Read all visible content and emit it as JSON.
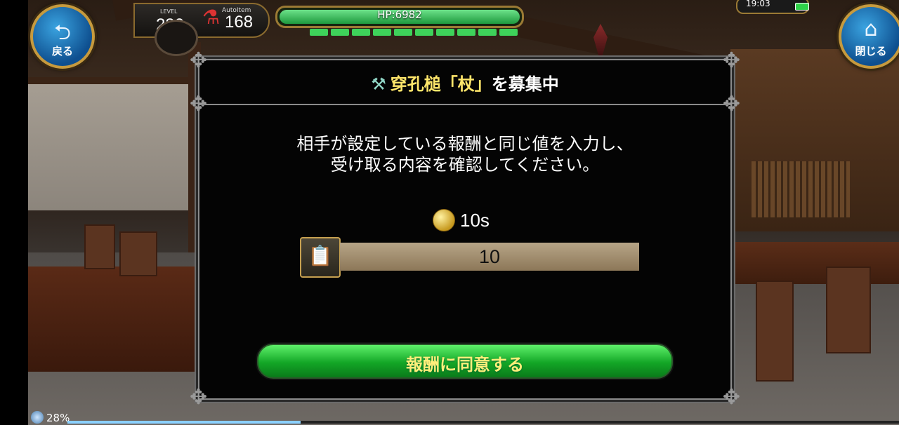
{
  "hud": {
    "back_label": "戻る",
    "close_label": "閉じる",
    "level_caption": "LEVEL",
    "level_value": "230",
    "autoitem_caption": "AutoItem",
    "autoitem_value": "168",
    "hp_text": "HP:6982",
    "ap_segments": 10,
    "clock": "19:03"
  },
  "dialog": {
    "title_item": "穿孔槌「杖」",
    "title_suffix": "を募集中",
    "message_line1": "相手が設定している報酬と同じ値を入力し、",
    "message_line2": "受け取る内容を確認してください。",
    "reward_value": "10s",
    "input_value": "10",
    "agree_label": "報酬に同意する"
  },
  "download": {
    "percent_text": "28%",
    "progress": 0.28
  },
  "colors": {
    "accent_green": "#13a626",
    "title_highlight": "#ffe66b",
    "frame_gold": "#c69a3e"
  },
  "icons": {
    "back": "back-arrow-icon",
    "close": "home-icon",
    "title": "hammer-icon",
    "reward": "coin-icon",
    "input": "clipboard-icon"
  }
}
